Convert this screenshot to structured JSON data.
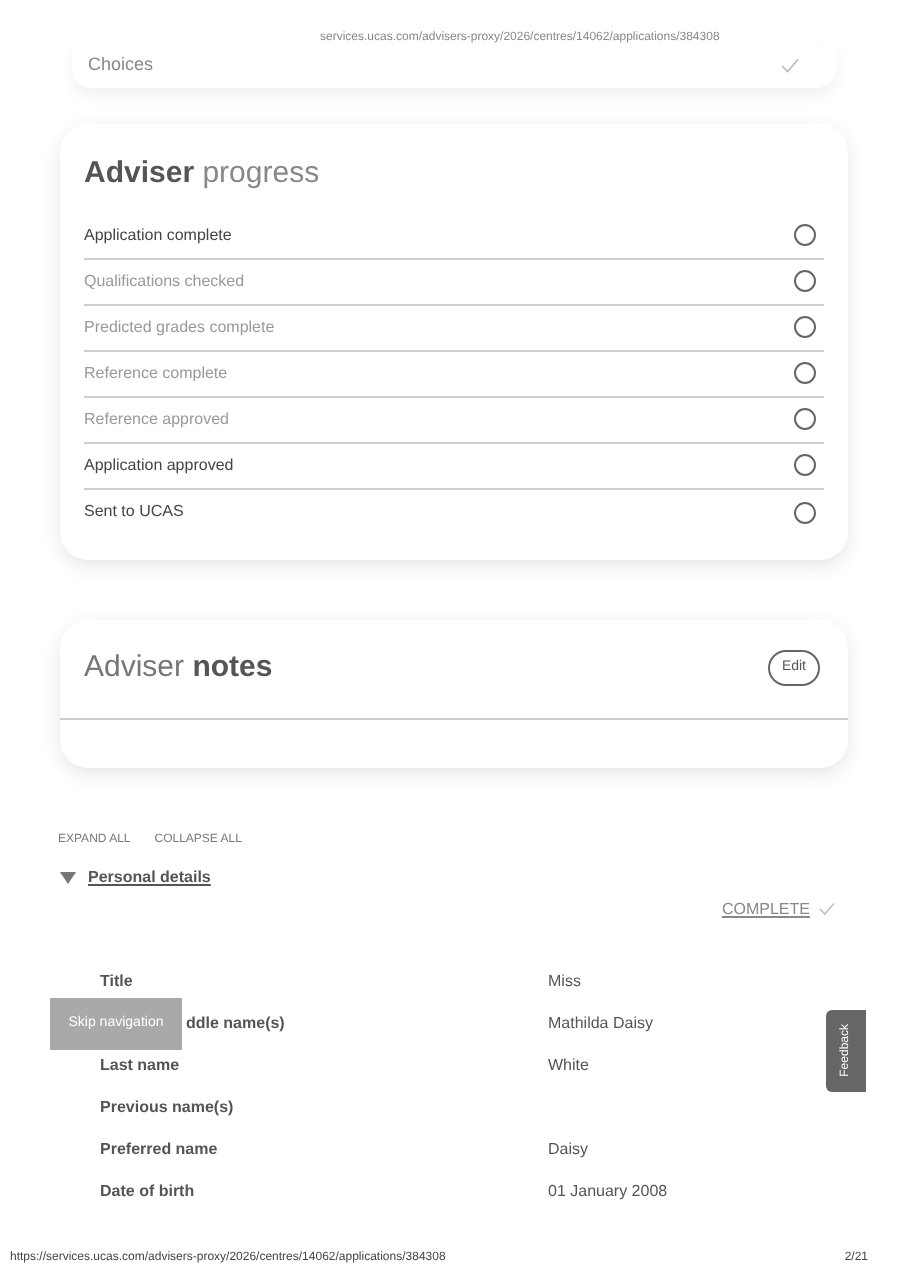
{
  "print_header": {
    "url": "services.ucas.com/advisers-proxy/2026/centres/14062/applications/384308"
  },
  "choices_card": {
    "label": "Choices",
    "complete": true
  },
  "adviser_progress": {
    "title_bold": "Adviser",
    "title_rest": "progress",
    "items": [
      {
        "label": "Application complete",
        "disabled": false,
        "checked": false
      },
      {
        "label": "Qualifications checked",
        "disabled": true,
        "checked": false
      },
      {
        "label": "Predicted grades complete",
        "disabled": true,
        "checked": false
      },
      {
        "label": "Reference complete",
        "disabled": true,
        "checked": false
      },
      {
        "label": "Reference approved",
        "disabled": true,
        "checked": false
      },
      {
        "label": "Application approved",
        "disabled": false,
        "checked": false
      },
      {
        "label": "Sent to UCAS",
        "disabled": false,
        "checked": false
      }
    ]
  },
  "adviser_notes": {
    "title_light": "Adviser",
    "title_bold": "notes",
    "edit_button": "Edit"
  },
  "section_controls": [
    "EXPAND ALL",
    "COLLAPSE ALL"
  ],
  "personal_details": {
    "title": "Personal details",
    "expanded": true,
    "status": "COMPLETE",
    "complete": true,
    "rows": [
      {
        "label": "Title",
        "value": "Miss",
        "kind": "plain"
      },
      {
        "label": "ddle name(s)",
        "value": "Mathilda Daisy",
        "kind": "covered"
      },
      {
        "label": "Last name",
        "value": "White",
        "kind": "plain"
      },
      {
        "label": "Previous name(s)",
        "kind": "plain"
      },
      {
        "label": "Preferred name",
        "value": "Daisy",
        "kind": "plain"
      },
      {
        "label": "Date of birth",
        "value": "01 January 2008",
        "kind": "plain"
      }
    ]
  },
  "skip_navigation": "Skip navigation",
  "feedback_tab": "Feedback",
  "print_footer": {
    "url": "https://services.ucas.com/advisers-proxy/2026/centres/14062/applications/384308",
    "page": "2/21"
  }
}
